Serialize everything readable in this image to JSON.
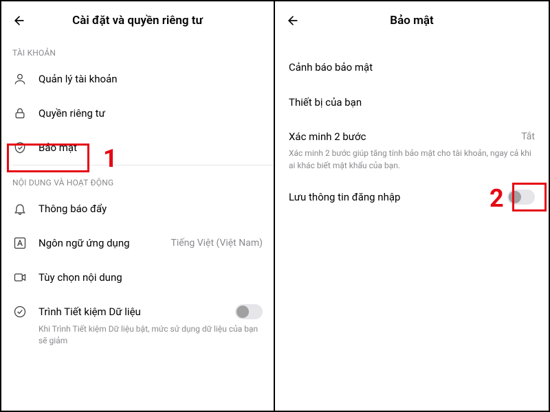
{
  "left": {
    "title": "Cài đặt và quyền riêng tư",
    "section_account": "TÀI KHOẢN",
    "account_manage": "Quản lý tài khoản",
    "privacy": "Quyền riêng tư",
    "security": "Bảo mật",
    "section_content": "NỘI DUNG VÀ HOẠT ĐỘNG",
    "push": "Thông báo đẩy",
    "language": "Ngôn ngữ ứng dụng",
    "language_value": "Tiếng Việt (Việt Nam)",
    "content_pref": "Tùy chọn nội dung",
    "data_saver": "Trình Tiết kiệm Dữ liệu",
    "data_saver_sub": "Khi Trình Tiết kiệm Dữ liệu bật, mức sử dụng dữ liệu của bạn sẽ giảm"
  },
  "right": {
    "title": "Bảo mật",
    "alert": "Cảnh báo bảo mật",
    "devices": "Thiết bị của bạn",
    "twostep": "Xác minh 2 bước",
    "twostep_value": "Tắt",
    "twostep_sub": "Xác minh 2 bước giúp tăng tính bảo mật cho tài khoản, ngay cả khi ai khác biết mật khẩu của bạn.",
    "save_login": "Lưu thông tin đăng nhập"
  },
  "annotations": {
    "step1": "1",
    "step2": "2"
  }
}
